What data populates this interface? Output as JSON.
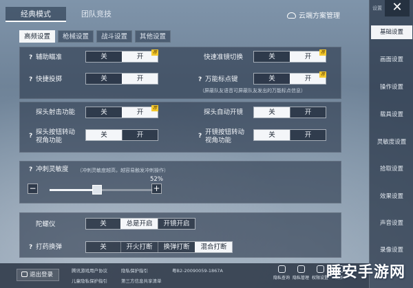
{
  "mode_tabs": [
    "经典模式",
    "团队竞技"
  ],
  "cloud_label": "云端方案管理",
  "sub_tabs": [
    "高频设置",
    "枪械设置",
    "战斗设置",
    "其他设置"
  ],
  "seg": {
    "off": "关",
    "on": "开",
    "badge": "荐"
  },
  "rows": {
    "aim_assist": "辅助瞄准",
    "quick_scope": "快速准镜切换",
    "quick_throw": "快捷投掷",
    "marker": "万能标点键",
    "marker_note": "（屏蔽队友语音可屏蔽队友发出的万能标点信息）",
    "peek_fire": "探头射击功能",
    "peek_auto_scope": "探头自动开镜",
    "peek_button_rotate": "探头按钮转动视角功能",
    "scope_button_rotate": "开镜按钮转动视角功能",
    "sprint_sensitivity": "冲刺灵敏度",
    "sprint_note": "（冲刺灵敏度越高，越容易触发冲刺操作）",
    "gyro": "陀螺仪",
    "shot_mode": "打药换弹"
  },
  "help_mark": "?",
  "sensitivity_percent": "52%",
  "sensitivity_value": 0.52,
  "gyro_options": [
    "关",
    "总是开启",
    "开镜开启"
  ],
  "fire_options": [
    "关",
    "开火打断",
    "换弹打断",
    "混合打断"
  ],
  "sidebar": {
    "top_label": "设置",
    "items": [
      "基础设置",
      "画面设置",
      "操作设置",
      "载具设置",
      "灵敏度设置",
      "拾取设置",
      "效果设置",
      "声音设置",
      "录像设置"
    ]
  },
  "bottom": {
    "logout": "退出登录",
    "links": [
      "腾讯游戏用户协议",
      "隐私保护指引",
      "儿童隐私保护指引",
      "第三方信息共享清单"
    ],
    "icp": "粤B2-20090059-1867A",
    "icons": [
      "隐私查询",
      "隐私管理",
      "权限设置",
      "更多"
    ]
  },
  "watermark": "睡安手游网"
}
